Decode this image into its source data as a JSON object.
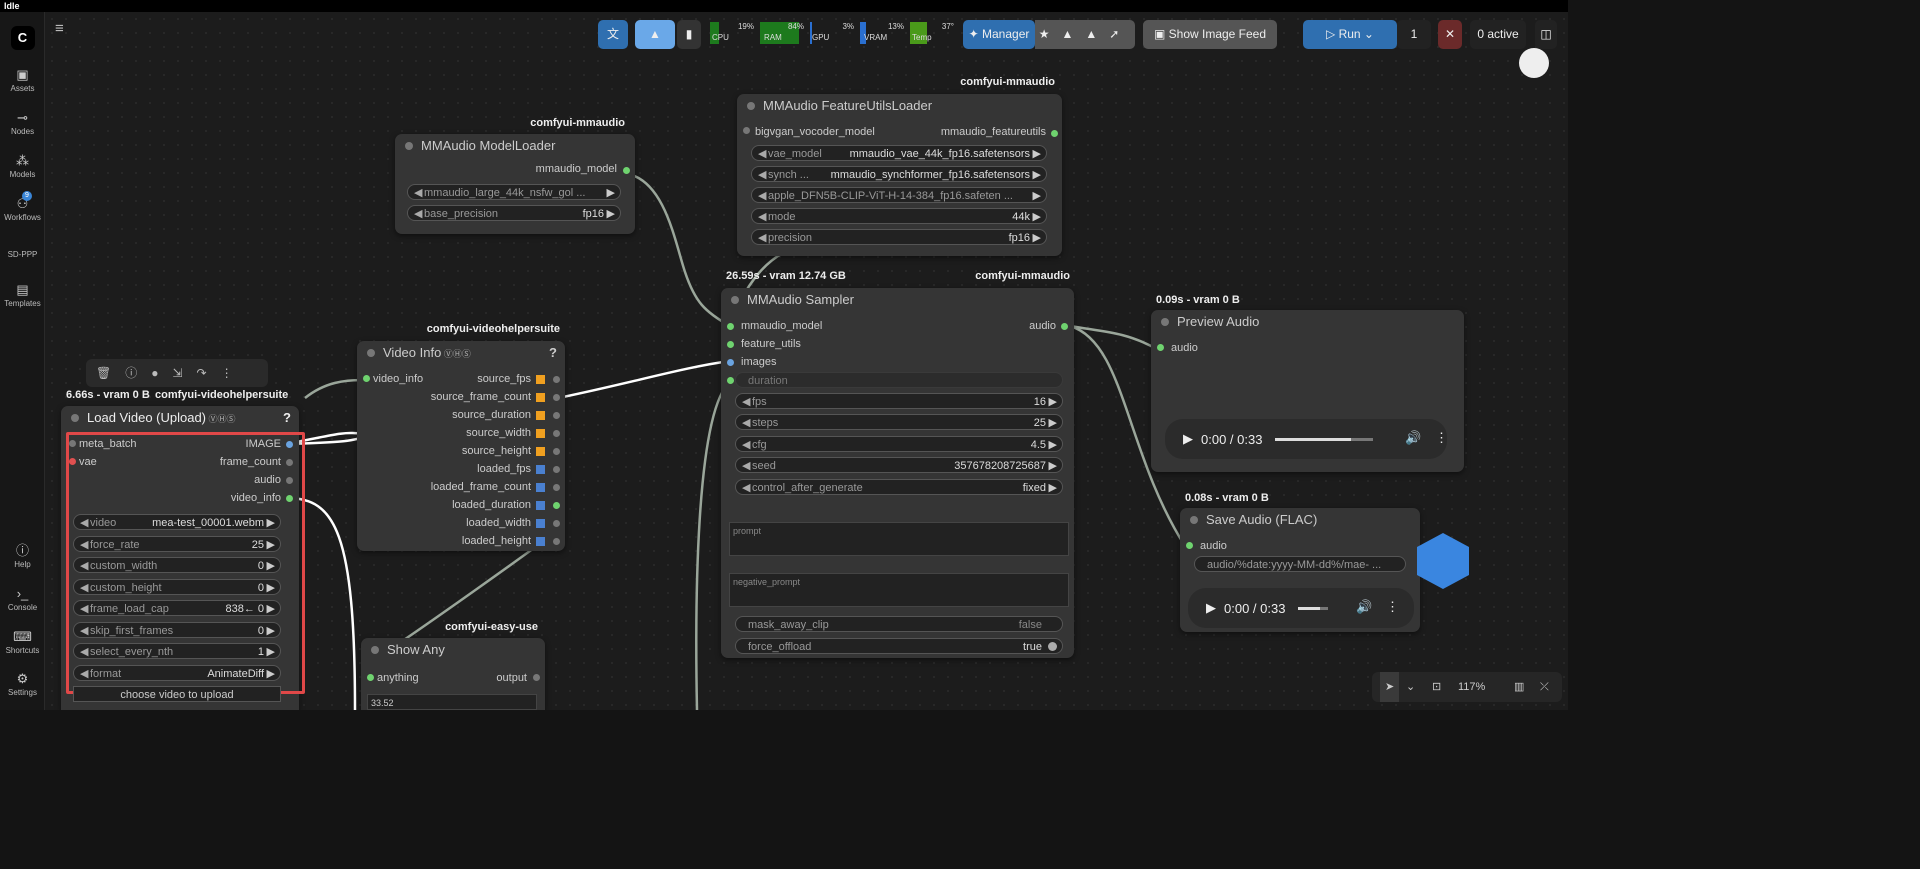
{
  "window": {
    "title": "Idle"
  },
  "sidebar": {
    "items": [
      {
        "label": "Assets",
        "icon": "image-icon"
      },
      {
        "label": "Nodes",
        "icon": "nodes-icon"
      },
      {
        "label": "Models",
        "icon": "models-icon"
      },
      {
        "label": "Workflows",
        "icon": "workflow-icon",
        "badge": "9"
      },
      {
        "label": "SD-PPP"
      },
      {
        "label": "Templates",
        "icon": "templates-icon"
      },
      {
        "label": "Help",
        "icon": "help-icon"
      },
      {
        "label": "Console",
        "icon": "console-icon"
      },
      {
        "label": "Shortcuts",
        "icon": "keyboard-icon"
      },
      {
        "label": "Settings",
        "icon": "gear-icon"
      }
    ]
  },
  "toolbar": {
    "cpu": {
      "label": "CPU",
      "value": "19%"
    },
    "ram": {
      "label": "RAM",
      "value": "84%"
    },
    "gpu": {
      "label": "GPU",
      "value": "3%"
    },
    "vram": {
      "label": "VRAM",
      "value": "13%"
    },
    "temp": {
      "label": "Temp",
      "value": "37°"
    },
    "manager": "Manager",
    "show_feed": "Show Image Feed",
    "run": "Run",
    "run_count": "1",
    "active": "0 active"
  },
  "nodes": {
    "modelloader": {
      "tag": "comfyui-mmaudio",
      "title": "MMAudio ModelLoader",
      "output": "mmaudio_model",
      "w1": "mmaudio_large_44k_nsfw_gol ...",
      "w2_label": "base_precision",
      "w2_value": "fp16"
    },
    "featureutils": {
      "tag": "comfyui-mmaudio",
      "title": "MMAudio FeatureUtilsLoader",
      "input": "bigvgan_vocoder_model",
      "output": "mmaudio_featureutils",
      "rows": [
        {
          "label": "vae_model",
          "value": "mmaudio_vae_44k_fp16.safetensors"
        },
        {
          "label": "synch ...",
          "value": "mmaudio_synchformer_fp16.safetensors"
        },
        {
          "label": "",
          "value": "apple_DFN5B-CLIP-ViT-H-14-384_fp16.safeten ..."
        },
        {
          "label": "mode",
          "value": "44k"
        },
        {
          "label": "precision",
          "value": "fp16"
        }
      ]
    },
    "sampler": {
      "time": "26.59s - vram 12.74 GB",
      "tag": "comfyui-mmaudio",
      "title": "MMAudio Sampler",
      "inputs": [
        "mmaudio_model",
        "feature_utils",
        "images"
      ],
      "output": "audio",
      "duration": "duration",
      "rows": [
        {
          "label": "fps",
          "value": "16"
        },
        {
          "label": "steps",
          "value": "25"
        },
        {
          "label": "cfg",
          "value": "4.5"
        },
        {
          "label": "seed",
          "value": "357678208725687"
        },
        {
          "label": "control_after_generate",
          "value": "fixed"
        }
      ],
      "prompt": "prompt",
      "negative_prompt": "negative_prompt",
      "mask_label": "mask_away_clip",
      "mask_value": "false",
      "offload_label": "force_offload",
      "offload_value": "true"
    },
    "preview": {
      "time": "0.09s - vram 0 B",
      "title": "Preview Audio",
      "input": "audio",
      "time_display": "0:00 / 0:33"
    },
    "save": {
      "time": "0.08s - vram 0 B",
      "title": "Save Audio (FLAC)",
      "input": "audio",
      "prefix": "audio/%date:yyyy-MM-dd%/mae- ...",
      "time_display": "0:00 / 0:33"
    },
    "videoinfo": {
      "tag": "comfyui-videohelpersuite",
      "title": "Video Info",
      "input": "video_info",
      "outputs": [
        "source_fps",
        "source_frame_count",
        "source_duration",
        "source_width",
        "source_height",
        "loaded_fps",
        "loaded_frame_count",
        "loaded_duration",
        "loaded_width",
        "loaded_height"
      ]
    },
    "loadvideo": {
      "time": "6.66s - vram 0 B",
      "tag": "comfyui-videohelpersuite",
      "title": "Load Video (Upload)",
      "inputs": [
        "meta_batch",
        "vae"
      ],
      "outputs": [
        "IMAGE",
        "frame_count",
        "audio",
        "video_info"
      ],
      "rows": [
        {
          "label": "video",
          "value": "mea-test_00001.webm"
        },
        {
          "label": "force_rate",
          "value": "25"
        },
        {
          "label": "custom_width",
          "value": "0"
        },
        {
          "label": "custom_height",
          "value": "0"
        },
        {
          "label": "frame_load_cap",
          "value": "838← 0"
        },
        {
          "label": "skip_first_frames",
          "value": "0"
        },
        {
          "label": "select_every_nth",
          "value": "1"
        },
        {
          "label": "format",
          "value": "AnimateDiff"
        }
      ],
      "upload": "choose video to upload"
    },
    "showany": {
      "tag": "comfyui-easy-use",
      "title": "Show Any",
      "input": "anything",
      "output": "output",
      "value": "33.52"
    }
  },
  "bottom": {
    "zoom": "117%"
  }
}
